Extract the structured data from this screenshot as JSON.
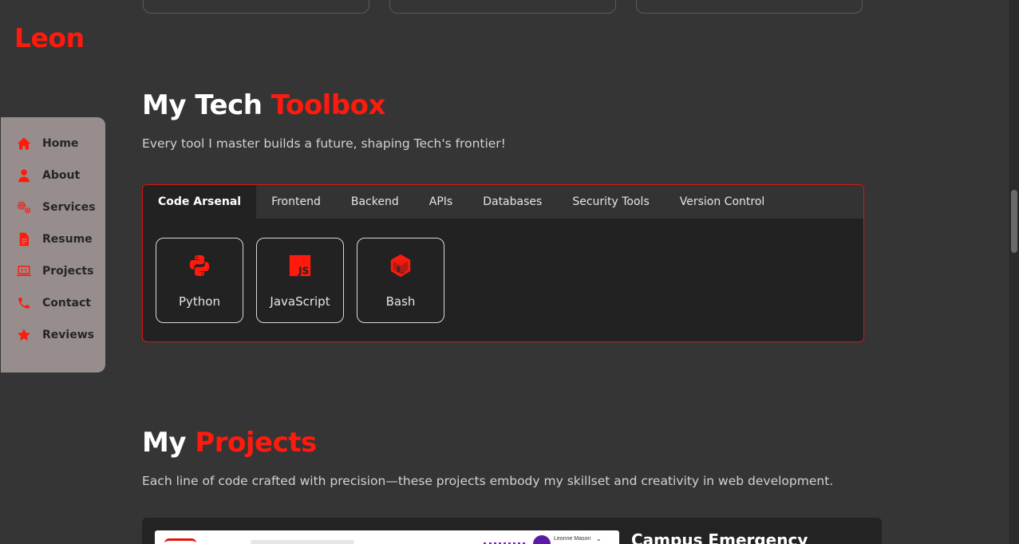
{
  "brand": {
    "name": "Leon",
    "accent": "#ff1a0d"
  },
  "sidebar": {
    "items": [
      {
        "label": "Home",
        "icon": "home-icon"
      },
      {
        "label": "About",
        "icon": "user-icon"
      },
      {
        "label": "Services",
        "icon": "gears-icon"
      },
      {
        "label": "Resume",
        "icon": "document-icon"
      },
      {
        "label": "Projects",
        "icon": "laptop-code-icon"
      },
      {
        "label": "Contact",
        "icon": "phone-icon"
      },
      {
        "label": "Reviews",
        "icon": "star-icon"
      }
    ]
  },
  "toolbox": {
    "title_main": "My Tech ",
    "title_accent": "Toolbox",
    "subtitle": "Every tool I master builds a future, shaping Tech's frontier!",
    "tabs": [
      "Code Arsenal",
      "Frontend",
      "Backend",
      "APIs",
      "Databases",
      "Security Tools",
      "Version Control"
    ],
    "active_tab": "Code Arsenal",
    "tools": [
      {
        "name": "Python",
        "icon": "python-icon"
      },
      {
        "name": "JavaScript",
        "icon": "javascript-icon"
      },
      {
        "name": "Bash",
        "icon": "bash-icon"
      }
    ]
  },
  "projects": {
    "title_main": "My ",
    "title_accent": "Projects",
    "subtitle": "Each line of code crafted with precision—these projects embody my skillset and creativity in web development.",
    "first_project_title": "Campus Emergency",
    "thumb_user": "Leonne Mason"
  }
}
